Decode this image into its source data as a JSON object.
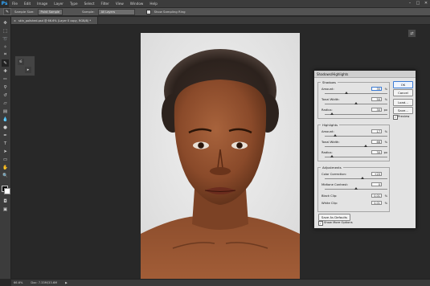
{
  "app": {
    "logo": "Ps"
  },
  "menu": [
    "File",
    "Edit",
    "Image",
    "Layer",
    "Type",
    "Select",
    "Filter",
    "View",
    "Window",
    "Help"
  ],
  "window_controls": [
    "–",
    "□",
    "✕"
  ],
  "options_bar": {
    "sample_size_label": "Sample Size:",
    "sample_size_value": "Point Sample",
    "sample_label": "Sample:",
    "sample_value": "All Layers",
    "show_sampling_ring": "Show Sampling Ring"
  },
  "document_tab": {
    "title": "skin_polished.psd @ 66.6% (Layer 0 copy, RGB/8) *",
    "close": "×"
  },
  "status_bar": {
    "zoom": "66.6%",
    "doc_info": "Doc: 7.33M/33.6M",
    "arrow": "▶"
  },
  "dialog": {
    "title": "Shadows/Highlights",
    "shadows": {
      "title": "Shadows",
      "amount_label": "Amount:",
      "amount_value": "35",
      "amount_unit": "%",
      "amount_level": 0.35,
      "tonal_width_label": "Tonal Width:",
      "tonal_width_value": "50",
      "tonal_width_unit": "%",
      "tonal_width_level": 0.5,
      "radius_label": "Radius:",
      "radius_value": "30",
      "radius_unit": "px",
      "radius_level": 0.12
    },
    "highlights": {
      "title": "Highlights",
      "amount_label": "Amount:",
      "amount_value": "17",
      "amount_unit": "%",
      "amount_level": 0.17,
      "tonal_width_label": "Tonal Width:",
      "tonal_width_value": "66",
      "tonal_width_unit": "%",
      "tonal_width_level": 0.66,
      "radius_label": "Radius:",
      "radius_value": "30",
      "radius_unit": "px",
      "radius_level": 0.12
    },
    "adjustments": {
      "title": "Adjustments",
      "color_correction_label": "Color Correction:",
      "color_correction_value": "+20",
      "color_correction_level": 0.6,
      "midtone_contrast_label": "Midtone Contrast:",
      "midtone_contrast_value": "0",
      "midtone_contrast_level": 0.5,
      "black_clip_label": "Black Clip:",
      "black_clip_value": "0.01",
      "black_clip_unit": "%",
      "white_clip_label": "White Clip:",
      "white_clip_value": "0.01",
      "white_clip_unit": "%"
    },
    "save_defaults": "Save As Defaults",
    "show_more_options": "Show More Options",
    "buttons": {
      "ok": "OK",
      "cancel": "Cancel",
      "load": "Load...",
      "save": "Save..."
    },
    "preview_label": "Preview",
    "preview_checked": "✓",
    "show_more_checked": "✓"
  },
  "colors": {
    "accent": "#31a8ff",
    "panel": "#3c3c3c",
    "dialog": "#e3e3e3"
  }
}
